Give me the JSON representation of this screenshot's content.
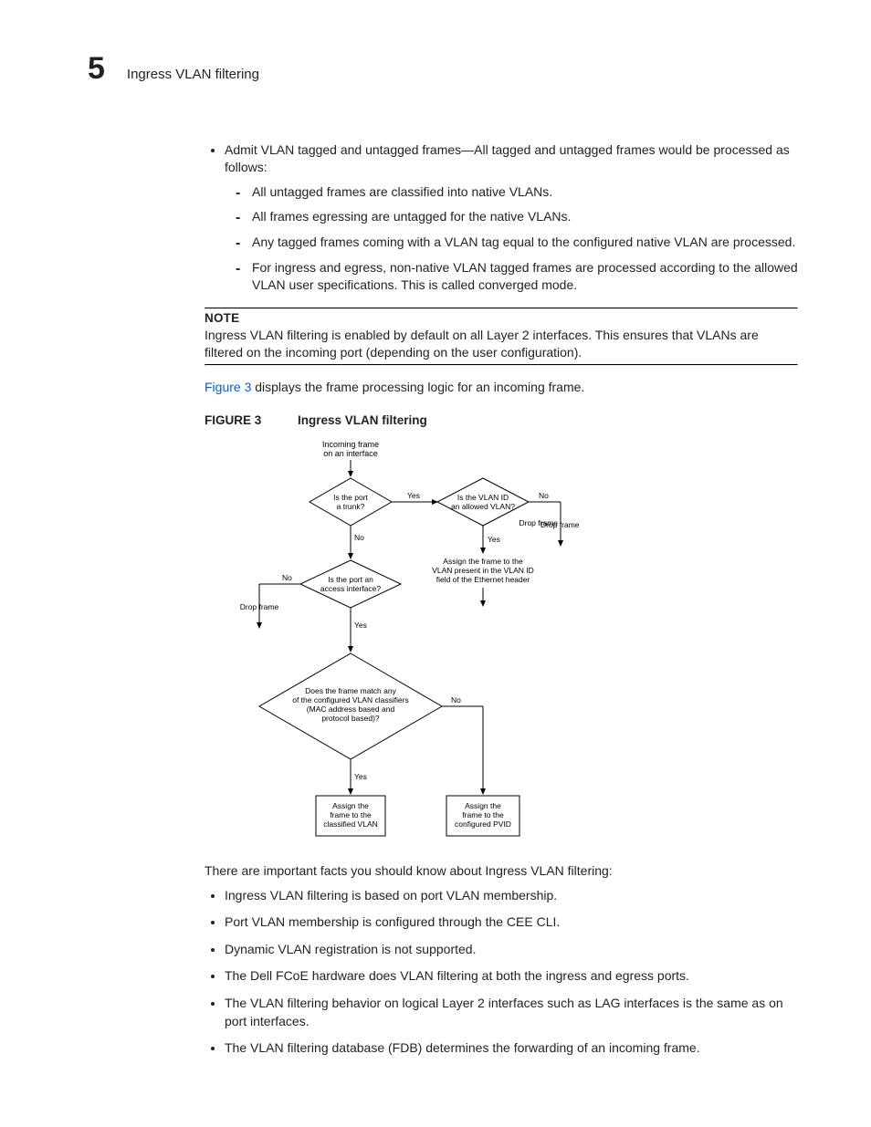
{
  "header": {
    "chapter_number": "5",
    "title": "Ingress VLAN filtering"
  },
  "bullet_intro": "Admit VLAN tagged and untagged frames—All tagged and untagged frames would be processed as follows:",
  "sub_bullets": [
    "All untagged frames are classified into native VLANs.",
    "All frames egressing are untagged for the native VLANs.",
    "Any tagged frames coming with a VLAN tag equal to the configured native VLAN are processed.",
    "For ingress and egress, non-native VLAN tagged frames are processed according to the allowed VLAN user specifications. This is called converged mode."
  ],
  "note": {
    "label": "NOTE",
    "text": "Ingress VLAN filtering is enabled by default on all Layer 2 interfaces. This ensures that VLANs are filtered on the incoming port (depending on the user configuration)."
  },
  "fig_ref_sentence_prefix": "Figure 3",
  "fig_ref_sentence_rest": " displays the frame processing logic for an incoming frame.",
  "figure": {
    "label": "FIGURE 3",
    "title": "Ingress VLAN filtering"
  },
  "diagram": {
    "start1": "Incoming frame",
    "start2": "on an interface",
    "d1a": "Is the port",
    "d1b": "a trunk?",
    "d2a": "Is the VLAN ID",
    "d2b": "an allowed VLAN?",
    "d3a": "Is the port an",
    "d3b": "access interface?",
    "d4a": "Does the frame match any",
    "d4b": "of the configured VLAN classifiers",
    "d4c": "(MAC address based and",
    "d4d": "protocol based)?",
    "yes": "Yes",
    "no": "No",
    "drop": "Drop frame",
    "assign_vlan_a": "Assign the frame to the",
    "assign_vlan_b": "VLAN present in the VLAN ID",
    "assign_vlan_c": "field of the Ethernet header",
    "box1a": "Assign the",
    "box1b": "frame to the",
    "box1c": "classified VLAN",
    "box2a": "Assign the",
    "box2b": "frame to the",
    "box2c": "configured PVID"
  },
  "facts_intro": "There are important facts you should know about Ingress VLAN filtering:",
  "facts": [
    "Ingress VLAN filtering is based on port VLAN membership.",
    "Port VLAN membership is configured through the CEE CLI.",
    "Dynamic VLAN registration is not supported.",
    "The Dell FCoE hardware does VLAN filtering at both the ingress and egress ports.",
    "The VLAN filtering behavior on logical Layer 2 interfaces such as LAG interfaces is the same as on port interfaces.",
    "The VLAN filtering database (FDB) determines the forwarding of an incoming frame."
  ]
}
